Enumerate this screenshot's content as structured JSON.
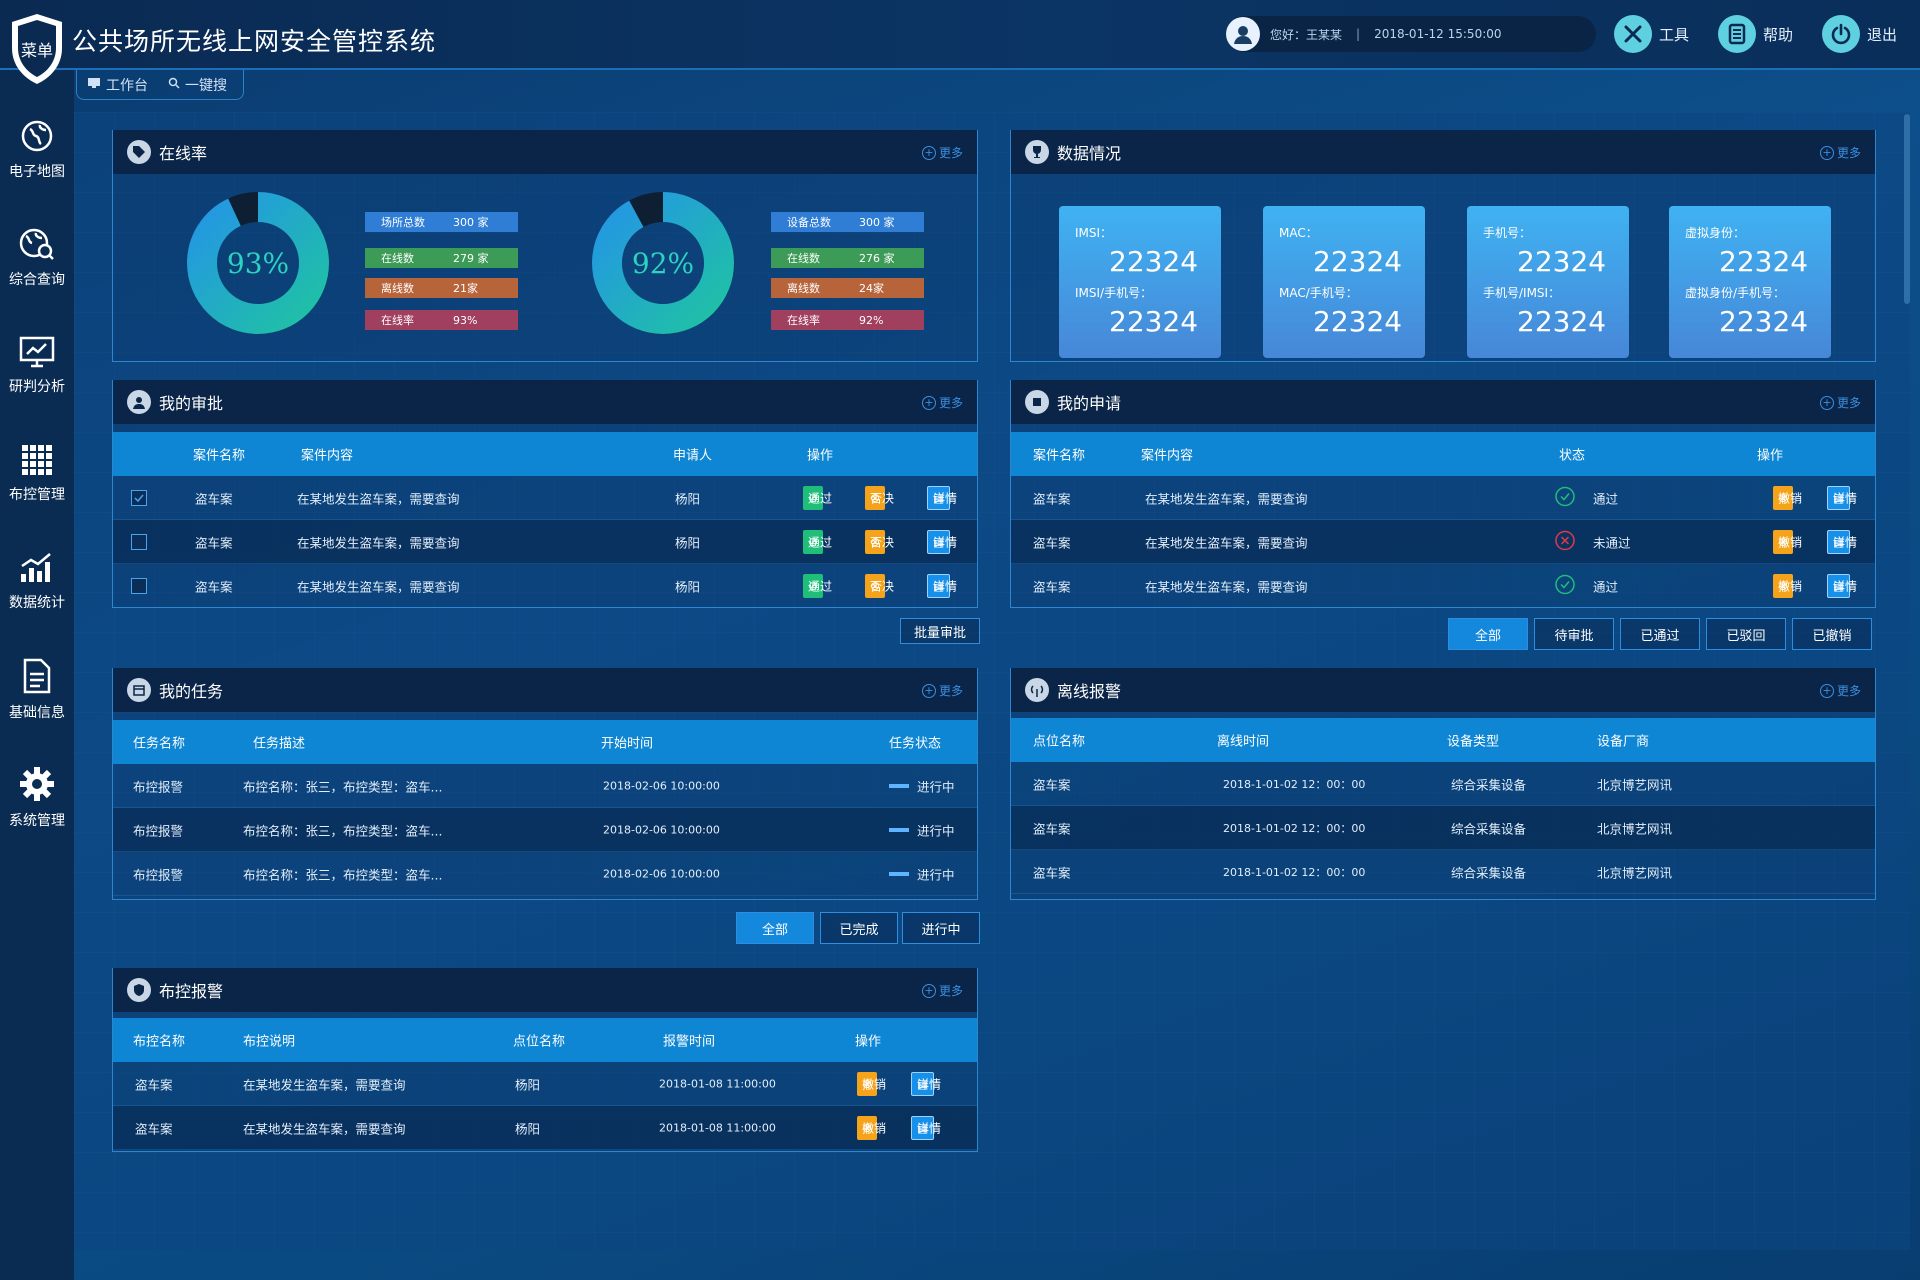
{
  "header": {
    "logo_text": "菜单",
    "title": "公共场所无线上网安全管控系统",
    "greeting": "您好：王某某",
    "datetime": "2018-01-12 15:50:00",
    "tools_label": "工具",
    "help_label": "帮助",
    "logout_label": "退出"
  },
  "quicktabs": {
    "workbench": "工作台",
    "search": "一键搜"
  },
  "sidebar": {
    "items": [
      {
        "label": "电子地图",
        "icon": "globe-icon"
      },
      {
        "label": "综合查询",
        "icon": "globe-search-icon"
      },
      {
        "label": "研判分析",
        "icon": "monitor-chart-icon"
      },
      {
        "label": "布控管理",
        "icon": "grid-icon"
      },
      {
        "label": "数据统计",
        "icon": "bar-chart-icon"
      },
      {
        "label": "基础信息",
        "icon": "document-icon"
      },
      {
        "label": "系统管理",
        "icon": "gear-icon"
      }
    ]
  },
  "more_label": "更多",
  "online": {
    "title": "在线率",
    "gauges": [
      {
        "percent_text": "93%",
        "percent": 93,
        "legend": [
          {
            "label": "场所总数",
            "value": "300 家"
          },
          {
            "label": "在线数",
            "value": "279 家"
          },
          {
            "label": "离线数",
            "value": "21家"
          },
          {
            "label": "在线率",
            "value": "93%"
          }
        ]
      },
      {
        "percent_text": "92%",
        "percent": 92,
        "legend": [
          {
            "label": "设备总数",
            "value": "300 家"
          },
          {
            "label": "在线数",
            "value": "276 家"
          },
          {
            "label": "离线数",
            "value": "24家"
          },
          {
            "label": "在线率",
            "value": "92%"
          }
        ]
      }
    ],
    "colors": {
      "ring_start": "#1fc2a4",
      "ring_end": "#2496e4",
      "gap": "#0e1e33"
    }
  },
  "data_status": {
    "title": "数据情况",
    "cards": [
      {
        "l1": "IMSI：",
        "v1": "22324",
        "l2": "IMSI/手机号：",
        "v2": "22324"
      },
      {
        "l1": "MAC：",
        "v1": "22324",
        "l2": "MAC/手机号：",
        "v2": "22324"
      },
      {
        "l1": "手机号：",
        "v1": "22324",
        "l2": "手机号/IMSI：",
        "v2": "22324"
      },
      {
        "l1": "虚拟身份：",
        "v1": "22324",
        "l2": "虚拟身份/手机号：",
        "v2": "22324"
      }
    ]
  },
  "approval": {
    "title": "我的审批",
    "columns": [
      "案件名称",
      "案件内容",
      "申请人",
      "操作"
    ],
    "rows": [
      {
        "checked": true,
        "name": "盗车案",
        "content": "在某地发生盗车案，需要查询",
        "applicant": "杨阳"
      },
      {
        "checked": false,
        "name": "盗车案",
        "content": "在某地发生盗车案，需要查询",
        "applicant": "杨阳"
      },
      {
        "checked": false,
        "name": "盗车案",
        "content": "在某地发生盗车案，需要查询",
        "applicant": "杨阳"
      }
    ],
    "pass_label": "通过",
    "reject_label": "否决",
    "detail_label": "详情",
    "batch_label": "批量审批"
  },
  "application": {
    "title": "我的申请",
    "columns": [
      "案件名称",
      "案件内容",
      "状态",
      "操作"
    ],
    "rows": [
      {
        "name": "盗车案",
        "content": "在某地发生盗车案，需要查询",
        "status": "通过",
        "ok": true
      },
      {
        "name": "盗车案",
        "content": "在某地发生盗车案，需要查询",
        "status": "未通过",
        "ok": false
      },
      {
        "name": "盗车案",
        "content": "在某地发生盗车案，需要查询",
        "status": "通过",
        "ok": true
      }
    ],
    "cancel_label": "撤销",
    "detail_label": "详情",
    "filters": [
      "全部",
      "待审批",
      "已通过",
      "已驳回",
      "已撤销"
    ]
  },
  "tasks": {
    "title": "我的任务",
    "columns": [
      "任务名称",
      "任务描述",
      "开始时间",
      "任务状态"
    ],
    "rows": [
      {
        "name": "布控报警",
        "desc": "布控名称：张三，布控类型：盗车...",
        "start": "2018-02-06 10:00:00",
        "status": "进行中"
      },
      {
        "name": "布控报警",
        "desc": "布控名称：张三，布控类型：盗车...",
        "start": "2018-02-06 10:00:00",
        "status": "进行中"
      },
      {
        "name": "布控报警",
        "desc": "布控名称：张三，布控类型：盗车...",
        "start": "2018-02-06 10:00:00",
        "status": "进行中"
      }
    ],
    "filters": [
      "全部",
      "已完成",
      "进行中"
    ]
  },
  "offline_alarm": {
    "title": "离线报警",
    "columns": [
      "点位名称",
      "离线时间",
      "设备类型",
      "设备厂商"
    ],
    "rows": [
      {
        "point": "盗车案",
        "time": "2018-1-01-02 12：00：00",
        "type": "综合采集设备",
        "vendor": "北京博艺网讯"
      },
      {
        "point": "盗车案",
        "time": "2018-1-01-02 12：00：00",
        "type": "综合采集设备",
        "vendor": "北京博艺网讯"
      },
      {
        "point": "盗车案",
        "time": "2018-1-01-02 12：00：00",
        "type": "综合采集设备",
        "vendor": "北京博艺网讯"
      }
    ]
  },
  "control_alarm": {
    "title": "布控报警",
    "columns": [
      "布控名称",
      "布控说明",
      "点位名称",
      "报警时间",
      "操作"
    ],
    "rows": [
      {
        "name": "盗车案",
        "desc": "在某地发生盗车案，需要查询",
        "point": "杨阳",
        "time": "2018-01-08 11:00:00"
      },
      {
        "name": "盗车案",
        "desc": "在某地发生盗车案，需要查询",
        "point": "杨阳",
        "time": "2018-01-08 11:00:00"
      }
    ],
    "cancel_label": "撤销",
    "detail_label": "详情"
  }
}
